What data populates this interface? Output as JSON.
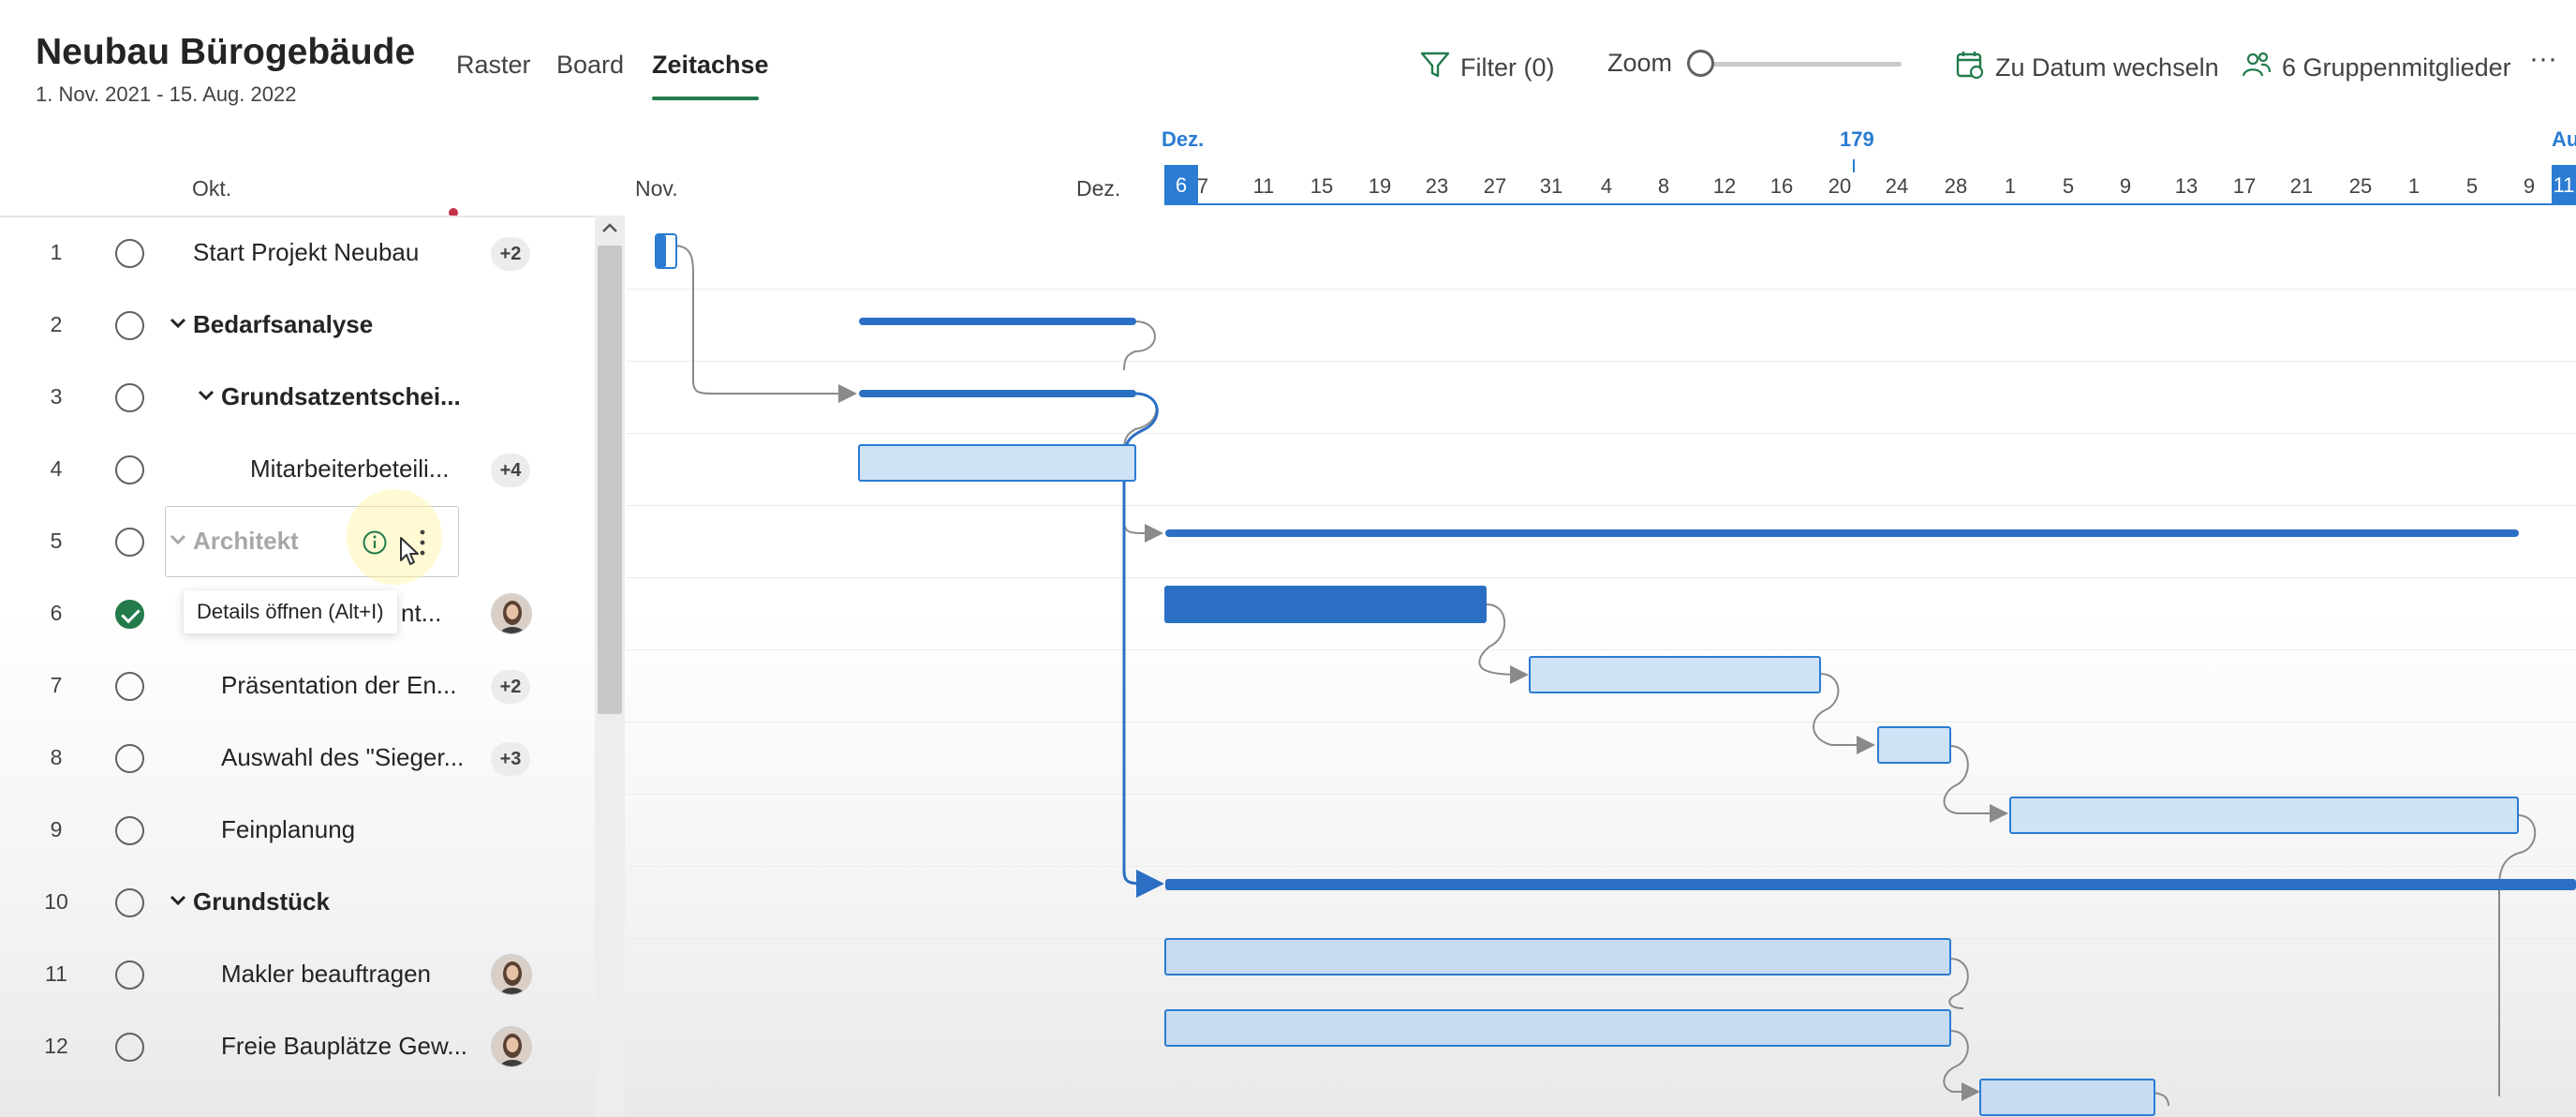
{
  "header": {
    "title": "Neubau Bürogebäude",
    "dates": "1. Nov. 2021 - 15. Aug. 2022",
    "tabs": [
      "Raster",
      "Board",
      "Zeitachse"
    ],
    "filter_label": "Filter (0)",
    "zoom_label": "Zoom",
    "goto_date_label": "Zu Datum wechseln",
    "members_label": "6 Gruppenmitglieder",
    "more_label": "···"
  },
  "timeline": {
    "month_okt": "Okt.",
    "month_nov": "Nov.",
    "month_dez": "Dez.",
    "month_dez_top": "Dez.",
    "week_number": "179",
    "month_aug_top": "Au",
    "current_day": "6",
    "days": [
      "7",
      "11",
      "15",
      "19",
      "23",
      "27",
      "31",
      "4",
      "8",
      "12",
      "16",
      "20",
      "24",
      "28",
      "1",
      "5",
      "9",
      "13",
      "17",
      "21",
      "25",
      "1",
      "5",
      "9"
    ],
    "end_day": "11"
  },
  "tasks": [
    {
      "num": "1",
      "name": "Start Projekt Neubau",
      "done": false,
      "bold": false,
      "indent": 0,
      "chevron": false,
      "badge": "+2",
      "avatar": false
    },
    {
      "num": "2",
      "name": "Bedarfsanalyse",
      "done": false,
      "bold": true,
      "indent": 0,
      "chevron": true,
      "badge": "",
      "avatar": false
    },
    {
      "num": "3",
      "name": "Grundsatzentschei...",
      "done": false,
      "bold": true,
      "indent": 1,
      "chevron": true,
      "badge": "",
      "avatar": false
    },
    {
      "num": "4",
      "name": "Mitarbeiterbeteili...",
      "done": false,
      "bold": false,
      "indent": 2,
      "chevron": false,
      "badge": "+4",
      "avatar": false
    },
    {
      "num": "5",
      "name": "Architekt",
      "done": false,
      "bold": true,
      "indent": 0,
      "chevron": true,
      "badge": "",
      "avatar": false
    },
    {
      "num": "6",
      "name": "nt...",
      "done": true,
      "bold": false,
      "indent": 1,
      "chevron": false,
      "badge": "",
      "avatar": true
    },
    {
      "num": "7",
      "name": "Präsentation der En...",
      "done": false,
      "bold": false,
      "indent": 1,
      "chevron": false,
      "badge": "+2",
      "avatar": false
    },
    {
      "num": "8",
      "name": "Auswahl des \"Sieger...",
      "done": false,
      "bold": false,
      "indent": 1,
      "chevron": false,
      "badge": "+3",
      "avatar": false
    },
    {
      "num": "9",
      "name": "Feinplanung",
      "done": false,
      "bold": false,
      "indent": 1,
      "chevron": false,
      "badge": "",
      "avatar": false
    },
    {
      "num": "10",
      "name": "Grundstück",
      "done": false,
      "bold": true,
      "indent": 0,
      "chevron": true,
      "badge": "",
      "avatar": false
    },
    {
      "num": "11",
      "name": "Makler beauftragen",
      "done": false,
      "bold": false,
      "indent": 1,
      "chevron": false,
      "badge": "",
      "avatar": true
    },
    {
      "num": "12",
      "name": "Freie Bauplätze Gew...",
      "done": false,
      "bold": false,
      "indent": 1,
      "chevron": false,
      "badge": "",
      "avatar": true
    }
  ],
  "tooltip": "Details öffnen (Alt+I)",
  "colors": {
    "accent_green": "#237b4b",
    "timeline_blue": "#2b7cd3",
    "summary_bar": "#2b6fc4",
    "task_bar_fill": "#cfe2f6",
    "task_bar_border": "#2b7cd3",
    "connector": "#8a8a8a"
  }
}
